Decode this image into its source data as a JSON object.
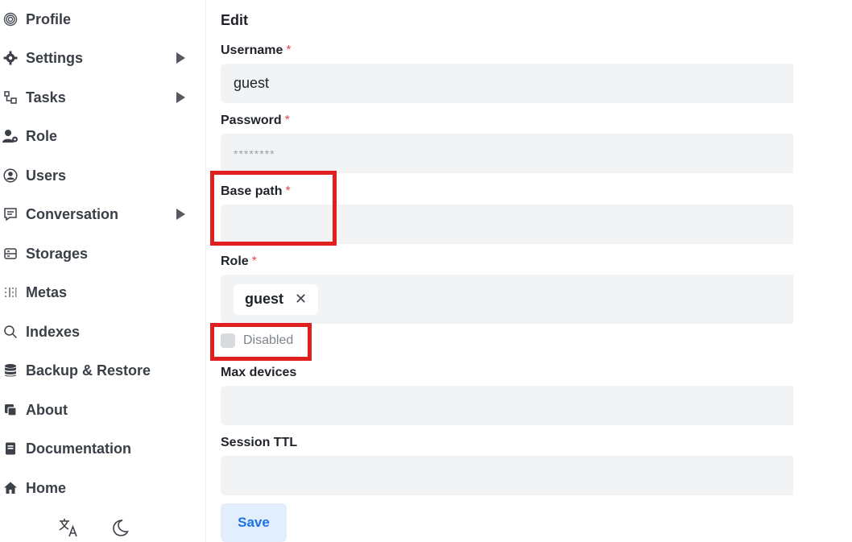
{
  "sidebar": {
    "items": [
      {
        "label": "Profile",
        "icon": "fingerprint-icon"
      },
      {
        "label": "Settings",
        "icon": "gear-icon"
      },
      {
        "label": "Tasks",
        "icon": "tasks-icon"
      },
      {
        "label": "Role",
        "icon": "user-gear-icon"
      },
      {
        "label": "Users",
        "icon": "user-circle-icon"
      },
      {
        "label": "Conversation",
        "icon": "chat-icon"
      },
      {
        "label": "Storages",
        "icon": "storage-icon"
      },
      {
        "label": "Metas",
        "icon": "metas-icon"
      },
      {
        "label": "Indexes",
        "icon": "search-icon"
      },
      {
        "label": "Backup & Restore",
        "icon": "database-icon"
      },
      {
        "label": "About",
        "icon": "copy-icon"
      },
      {
        "label": "Documentation",
        "icon": "book-icon"
      },
      {
        "label": "Home",
        "icon": "home-icon"
      }
    ],
    "bottom_icons": [
      "translate-icon",
      "moon-icon"
    ]
  },
  "form": {
    "title": "Edit",
    "username_label": "Username",
    "username_value": "guest",
    "password_label": "Password",
    "password_placeholder": "********",
    "base_path_label": "Base path",
    "base_path_value": "",
    "role_label": "Role",
    "role_chip": "guest",
    "role_chip_remove": "✕",
    "disabled_label": "Disabled",
    "disabled_checked": false,
    "max_devices_label": "Max devices",
    "max_devices_value": "",
    "session_ttl_label": "Session TTL",
    "session_ttl_value": "",
    "required_mark": "*",
    "save_label": "Save"
  },
  "colors": {
    "accent": "#1a73e8",
    "highlight": "#e0201e",
    "required": "#e5484d"
  }
}
